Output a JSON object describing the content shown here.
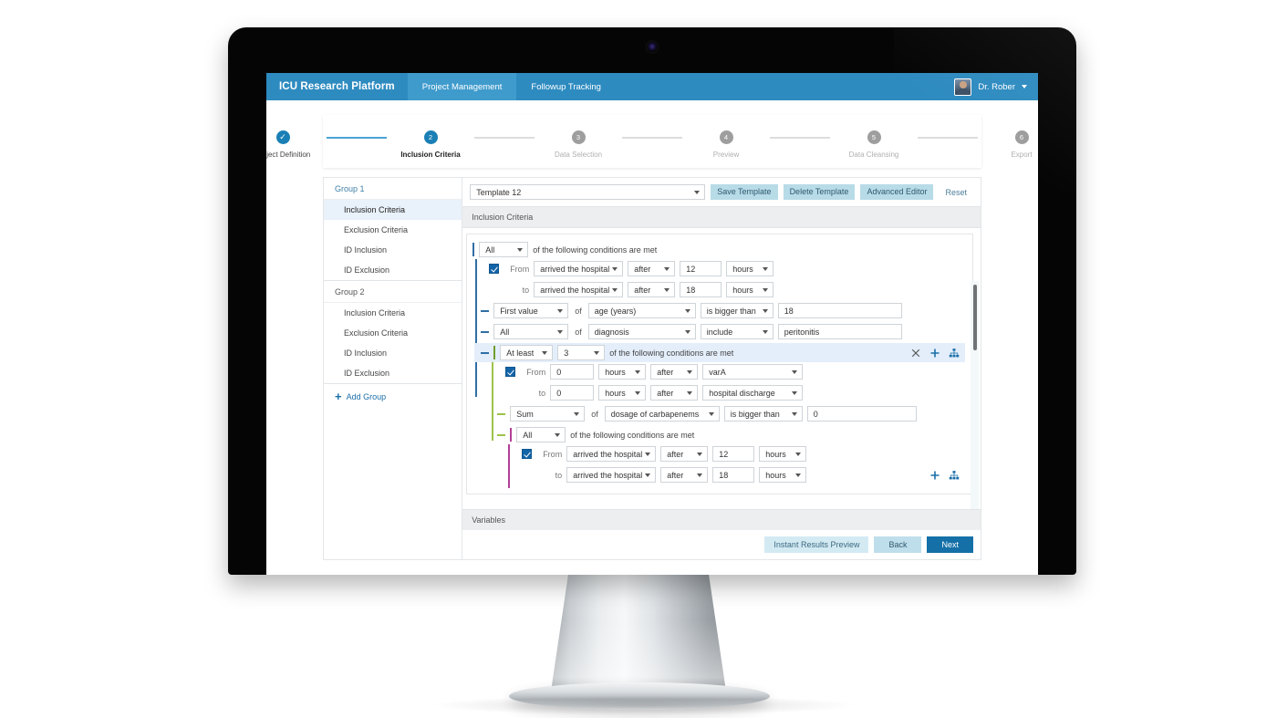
{
  "app": {
    "brand": "ICU Research Platform",
    "tabs": [
      {
        "label": "Project Management",
        "active": true
      },
      {
        "label": "Followup Tracking",
        "active": false
      }
    ],
    "user": {
      "name": "Dr. Rober",
      "avatar_icon": "user-avatar-photo",
      "caret_icon": "chevron-down-icon"
    }
  },
  "stepper": {
    "steps": [
      {
        "num": "✓",
        "label": "Project Definition",
        "state": "done"
      },
      {
        "num": "2",
        "label": "Inclusion Criteria",
        "state": "current"
      },
      {
        "num": "3",
        "label": "Data Selection",
        "state": "todo"
      },
      {
        "num": "4",
        "label": "Preview",
        "state": "todo"
      },
      {
        "num": "5",
        "label": "Data Cleansing",
        "state": "todo"
      },
      {
        "num": "6",
        "label": "Export",
        "state": "todo"
      }
    ]
  },
  "sidebar": {
    "groups": [
      {
        "title": "Group 1",
        "items": [
          {
            "label": "Inclusion Criteria",
            "active": true
          },
          {
            "label": "Exclusion Criteria",
            "active": false
          },
          {
            "label": "ID Inclusion",
            "active": false
          },
          {
            "label": "ID Exclusion",
            "active": false
          }
        ]
      },
      {
        "title": "Group 2",
        "items": [
          {
            "label": "Inclusion Criteria",
            "active": false
          },
          {
            "label": "Exclusion Criteria",
            "active": false
          },
          {
            "label": "ID Inclusion",
            "active": false
          },
          {
            "label": "ID Exclusion",
            "active": false
          }
        ]
      }
    ],
    "add_group": "Add Group"
  },
  "template_bar": {
    "template_value": "Template 12",
    "save_label": "Save Template",
    "delete_label": "Delete Template",
    "advanced_label": "Advanced Editor",
    "reset_label": "Reset"
  },
  "sections": {
    "inclusion_title": "Inclusion Criteria",
    "variables_title": "Variables"
  },
  "builder": {
    "root": {
      "quantifier": "All",
      "text": "of the following conditions are met"
    },
    "rows": [
      {
        "type": "timerange",
        "from_label": "From",
        "to_label": "to",
        "checked": true,
        "from": {
          "event": "arrived the hospital",
          "rel": "after",
          "value": "12",
          "unit": "hours"
        },
        "to": {
          "event": "arrived the hospital",
          "rel": "after",
          "value": "18",
          "unit": "hours"
        }
      },
      {
        "type": "comparison",
        "agg": "First value",
        "of": "of",
        "field": "age (years)",
        "op": "is bigger than",
        "value": "18"
      },
      {
        "type": "comparison",
        "agg": "All",
        "of": "of",
        "field": "diagnosis",
        "op": "include",
        "value": "peritonitis"
      }
    ],
    "nested_group_1": {
      "quantifier": "At least",
      "count": "3",
      "text": "of the following conditions are met",
      "icons": {
        "close": "close-icon",
        "add": "add-icon",
        "group": "group-hierarchy-icon"
      },
      "rows": [
        {
          "type": "timerange-numfirst",
          "from_label": "From",
          "to_label": "to",
          "checked": true,
          "from": {
            "value": "0",
            "unit": "hours",
            "rel": "after",
            "event": "varA"
          },
          "to": {
            "value": "0",
            "unit": "hours",
            "rel": "after",
            "event": "hospital discharge"
          }
        },
        {
          "type": "comparison",
          "agg": "Sum",
          "of": "of",
          "field": "dosage of carbapenems",
          "op": "is bigger than",
          "value": "0"
        }
      ],
      "nested_group_2": {
        "quantifier": "All",
        "text": "of the following conditions are met",
        "icons": {
          "add": "add-icon",
          "group": "group-hierarchy-icon"
        },
        "rows": [
          {
            "type": "timerange",
            "from_label": "From",
            "to_label": "to",
            "checked": true,
            "from": {
              "event": "arrived the hospital",
              "rel": "after",
              "value": "12",
              "unit": "hours"
            },
            "to": {
              "event": "arrived the hospital",
              "rel": "after",
              "value": "18",
              "unit": "hours"
            }
          }
        ]
      }
    }
  },
  "footer": {
    "instant_label": "Instant Results Preview",
    "back_label": "Back",
    "next_label": "Next"
  },
  "colors": {
    "header_blue": "#2e8bc0",
    "active_tab": "#3f9bcc",
    "step_active": "#1a7fb5",
    "primary_button": "#1570a8",
    "light_button": "#b8dbe8",
    "rail_level1": "#2f6ea4",
    "rail_level2": "#9ec24a",
    "rail_level3": "#b23f96",
    "highlight_row": "#e4eefb",
    "checkbox": "#1364a8"
  }
}
